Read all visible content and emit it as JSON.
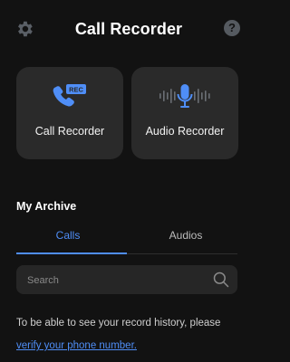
{
  "header": {
    "title": "Call Recorder",
    "settings_icon": "gear-icon",
    "help_label": "?",
    "help_icon": "help-icon"
  },
  "cards": [
    {
      "label": "Call Recorder",
      "icon": "phone-rec-icon",
      "badge": "REC"
    },
    {
      "label": "Audio Recorder",
      "icon": "microphone-waveform-icon"
    }
  ],
  "archive": {
    "title": "My Archive",
    "tabs": [
      {
        "label": "Calls",
        "selected": true
      },
      {
        "label": "Audios",
        "selected": false
      }
    ]
  },
  "search": {
    "placeholder": "Search",
    "value": "",
    "icon": "search-icon"
  },
  "message": {
    "text": "To be able to see your record history, please",
    "link": "verify your phone number."
  },
  "colors": {
    "background": "#121212",
    "card": "#2a2a2a",
    "accent": "#4f8ef7"
  }
}
